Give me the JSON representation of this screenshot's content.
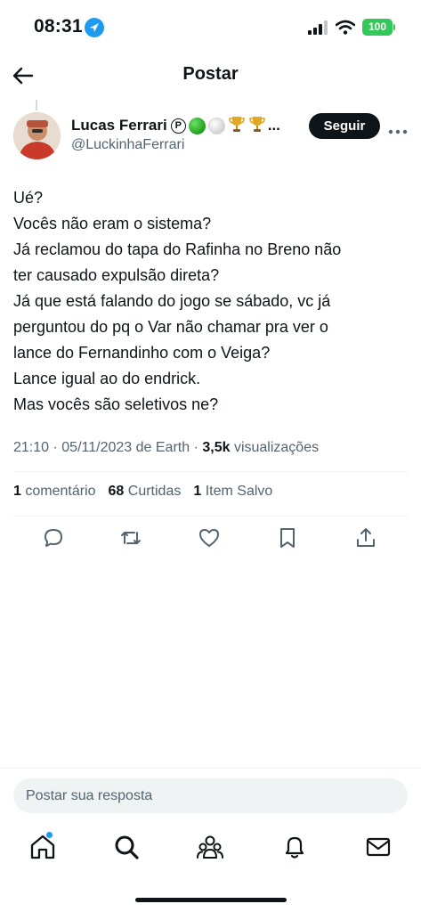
{
  "status_bar": {
    "time": "08:31",
    "battery": "100",
    "icons": [
      "location-arrow-icon",
      "signal-icon",
      "wifi-icon",
      "battery-icon"
    ]
  },
  "header": {
    "title": "Postar",
    "back_icon": "arrow-left-icon"
  },
  "author": {
    "name": "Lucas Ferrari",
    "handle": "@LuckinhaFerrari",
    "name_suffix": "...",
    "badge_letter": "P",
    "emojis": [
      "green-circle",
      "white-circle",
      "trophy",
      "trophy"
    ],
    "follow_label": "Seguir"
  },
  "tweet": {
    "lines": [
      "Ué?",
      "Vocês não eram o sistema?",
      "Já reclamou do tapa do Rafinha no Breno não",
      "ter causado expulsão direta?",
      "Já que está falando do jogo se sábado, vc já",
      "perguntou do pq o Var não chamar pra ver o",
      "lance do Fernandinho com o Veiga?",
      "Lance igual ao do endrick.",
      "Mas vocês são seletivos ne?"
    ]
  },
  "meta": {
    "time": "21:10",
    "date": "05/11/2023",
    "source": "de Earth",
    "views_count": "3,5k",
    "views_label": "visualizações",
    "separator": "·"
  },
  "stats": {
    "comments_count": "1",
    "comments_label": "comentário",
    "likes_count": "68",
    "likes_label": "Curtidas",
    "saves_count": "1",
    "saves_label": "Item Salvo"
  },
  "actions": [
    "reply-icon",
    "retweet-icon",
    "like-icon",
    "bookmark-icon",
    "share-icon"
  ],
  "reply": {
    "placeholder": "Postar sua resposta"
  },
  "tabbar": [
    "home-icon",
    "search-icon",
    "communities-icon",
    "notifications-icon",
    "messages-icon"
  ],
  "colors": {
    "accent": "#1d9bf0",
    "text": "#0f1419",
    "secondary_text": "#536471",
    "follow_button_bg": "#0f1419",
    "battery": "#34c759"
  }
}
